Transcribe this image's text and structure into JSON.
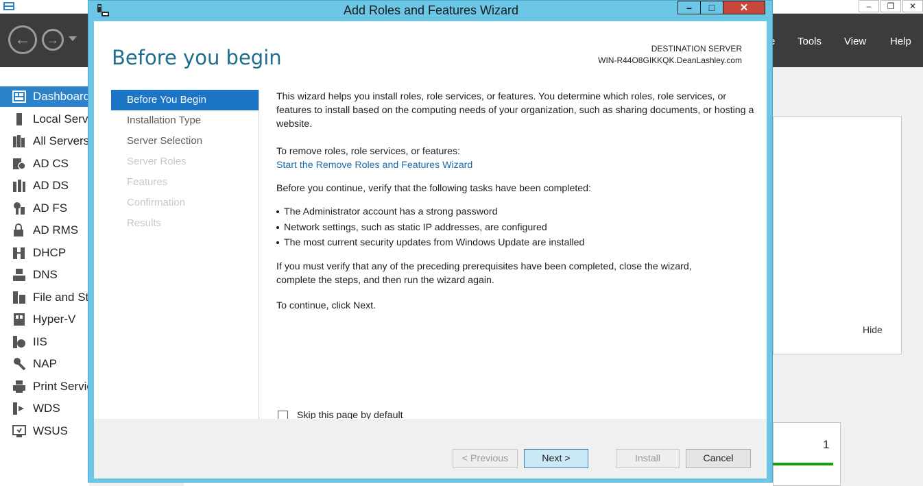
{
  "server_manager": {
    "menu": {
      "manage_partial": "e",
      "tools": "Tools",
      "view": "View",
      "help": "Help"
    },
    "window_controls": [
      "–",
      "❐",
      "✕"
    ],
    "sidebar": {
      "items": [
        {
          "label": "Dashboard",
          "icon": "dashboard-icon",
          "active": true
        },
        {
          "label": "Local Server",
          "icon": "local-server-icon"
        },
        {
          "label": "All Servers",
          "icon": "all-servers-icon"
        },
        {
          "label": "AD CS",
          "icon": "ad-cs-icon"
        },
        {
          "label": "AD DS",
          "icon": "ad-ds-icon"
        },
        {
          "label": "AD FS",
          "icon": "ad-fs-icon"
        },
        {
          "label": "AD RMS",
          "icon": "ad-rms-icon"
        },
        {
          "label": "DHCP",
          "icon": "dhcp-icon"
        },
        {
          "label": "DNS",
          "icon": "dns-icon"
        },
        {
          "label": "File and Storage Services",
          "icon": "file-storage-icon"
        },
        {
          "label": "Hyper-V",
          "icon": "hyper-v-icon"
        },
        {
          "label": "IIS",
          "icon": "iis-icon"
        },
        {
          "label": "NAP",
          "icon": "nap-icon"
        },
        {
          "label": "Print Services",
          "icon": "print-icon"
        },
        {
          "label": "WDS",
          "icon": "wds-icon"
        },
        {
          "label": "WSUS",
          "icon": "wsus-icon"
        }
      ]
    },
    "panel": {
      "hide_label": "Hide",
      "count": "1"
    },
    "colors": {
      "nav_bg": "#3c3c3c",
      "sidebar_active": "#2d83c9",
      "status_green": "#13a10e"
    }
  },
  "wizard": {
    "title": "Add Roles and Features Wizard",
    "header": "Before you begin",
    "destination_label": "DESTINATION SERVER",
    "destination_server": "WIN-R44O8GIKKQK.DeanLashley.com",
    "controls": {
      "minimize": "–",
      "maximize": "□",
      "close": "✕"
    },
    "steps": [
      {
        "label": "Before You Begin",
        "state": "active"
      },
      {
        "label": "Installation Type",
        "state": "enabled"
      },
      {
        "label": "Server Selection",
        "state": "enabled"
      },
      {
        "label": "Server Roles",
        "state": "disabled"
      },
      {
        "label": "Features",
        "state": "disabled"
      },
      {
        "label": "Confirmation",
        "state": "disabled"
      },
      {
        "label": "Results",
        "state": "disabled"
      }
    ],
    "content": {
      "intro": "This wizard helps you install roles, role services, or features. You determine which roles, role services, or features to install based on the computing needs of your organization, such as sharing documents, or hosting a website.",
      "remove_prompt": "To remove roles, role services, or features:",
      "remove_link": "Start the Remove Roles and Features Wizard",
      "verify_prompt": "Before you continue, verify that the following tasks have been completed:",
      "bullets": [
        "The Administrator account has a strong password",
        "Network settings, such as static IP addresses, are configured",
        "The most current security updates from Windows Update are installed"
      ],
      "prereq_note": "If you must verify that any of the preceding prerequisites have been completed, close the wizard, complete the steps, and then run the wizard again.",
      "continue_note": "To continue, click Next."
    },
    "skip_label": "Skip this page by default",
    "skip_checked": false,
    "buttons": {
      "previous": "< Previous",
      "next": "Next >",
      "install": "Install",
      "cancel": "Cancel"
    },
    "colors": {
      "frame": "#6cc7e6",
      "header_text": "#1e6e8e",
      "active_step": "#1b74c4",
      "link": "#1a6aa8",
      "close_button": "#c7483b"
    }
  }
}
